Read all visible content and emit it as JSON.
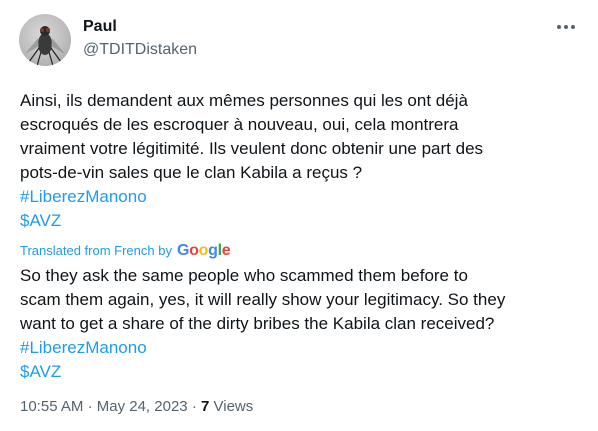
{
  "author": {
    "name": "Paul",
    "handle": "@TDITDistaken"
  },
  "original": {
    "lines": [
      "Ainsi, ils demandent aux mêmes personnes qui les ont déjà",
      "escroqués de les escroquer à nouveau, oui, cela montrera",
      "vraiment votre légitimité. Ils veulent donc obtenir une part des",
      "pots-de-vin sales que le clan Kabila a reçus ?"
    ],
    "hashtags": [
      "#LiberezManono",
      "$AVZ"
    ]
  },
  "translation": {
    "label": "Translated from French by",
    "provider": "Google",
    "lines": [
      "So they ask the same people who scammed them before to",
      "scam them again, yes, it will really show your legitimacy. So they",
      "want to get a share of the dirty bribes the Kabila clan received?"
    ],
    "hashtags": [
      "#LiberezManono",
      "$AVZ"
    ]
  },
  "meta": {
    "time": "10:55 AM",
    "sep1": "·",
    "date": "May 24, 2023",
    "sep2": "·",
    "views_count": "7",
    "views_label": "Views"
  },
  "colors": {
    "link": "#1d9bf0",
    "secondary_text": "#536471",
    "primary_text": "#0f1419"
  },
  "icons": {
    "more": "more-horizontal-icon",
    "avatar": "fly-photo"
  }
}
